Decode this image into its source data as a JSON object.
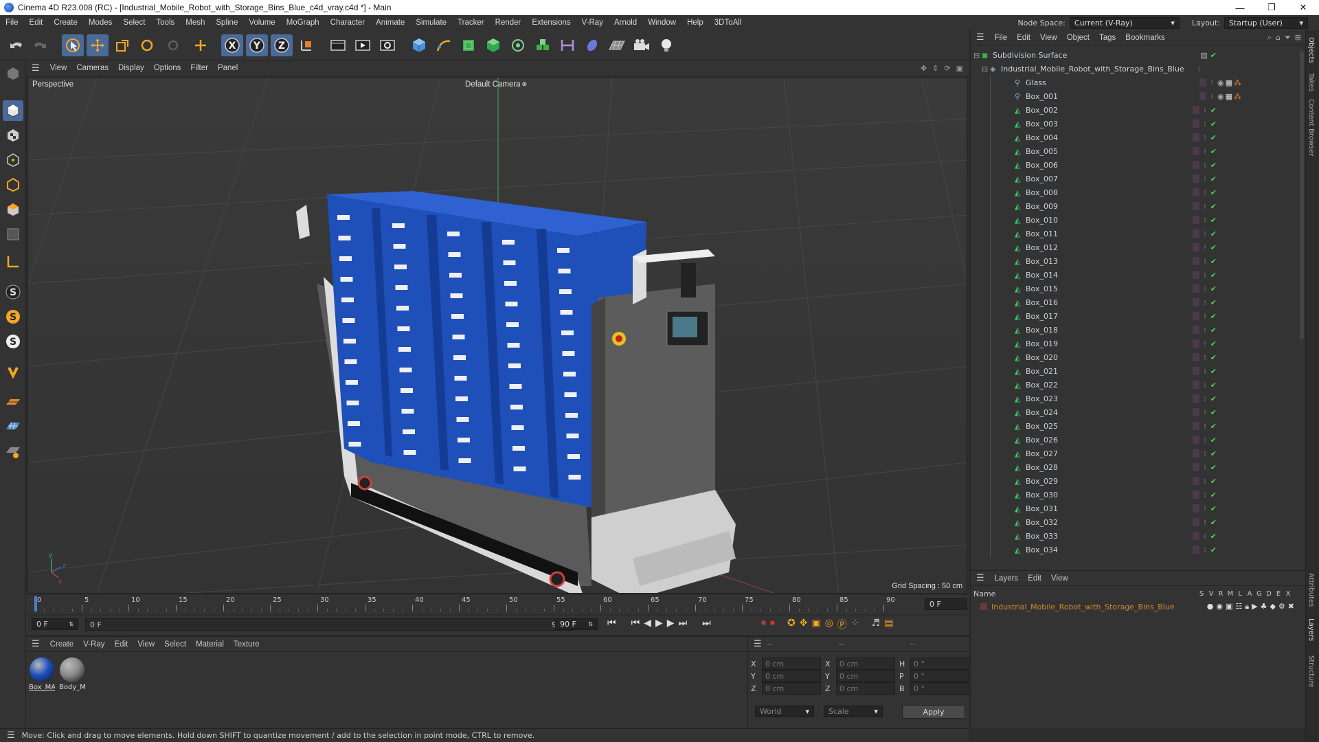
{
  "window": {
    "title": "Cinema 4D R23.008 (RC) - [Industrial_Mobile_Robot_with_Storage_Bins_Blue_c4d_vray.c4d *] - Main",
    "minimize": "—",
    "restore": "❐",
    "close": "✕"
  },
  "menubar": {
    "items": [
      "File",
      "Edit",
      "Create",
      "Modes",
      "Select",
      "Tools",
      "Mesh",
      "Spline",
      "Volume",
      "MoGraph",
      "Character",
      "Animate",
      "Simulate",
      "Tracker",
      "Render",
      "Extensions",
      "V-Ray",
      "Arnold",
      "Window",
      "Help",
      "3DToAll"
    ],
    "node_space_label": "Node Space:",
    "node_space_value": "Current (V-Ray)",
    "layout_label": "Layout:",
    "layout_value": "Startup (User)"
  },
  "viewport": {
    "menu": [
      "View",
      "Cameras",
      "Display",
      "Options",
      "Filter",
      "Panel"
    ],
    "view_name": "Perspective",
    "camera": "Default Camera",
    "grid_spacing": "Grid Spacing : 50 cm"
  },
  "timeline": {
    "ticks": [
      "0",
      "5",
      "10",
      "15",
      "20",
      "25",
      "30",
      "35",
      "40",
      "45",
      "50",
      "55",
      "60",
      "65",
      "70",
      "75",
      "80",
      "85",
      "90"
    ],
    "current_frame_right": "0 F",
    "start_field": "0 F",
    "range_start": "0 F",
    "range_end": "90 F",
    "end_field": "90 F"
  },
  "materials": {
    "menu": [
      "Create",
      "V-Ray",
      "Edit",
      "View",
      "Select",
      "Material",
      "Texture"
    ],
    "items": [
      {
        "name": "Box_MAT",
        "color": "#1e4fbf"
      },
      {
        "name": "Body_MAT",
        "color": "#8a8a8a"
      }
    ]
  },
  "coords": {
    "headers": [
      "--",
      "--",
      "--"
    ],
    "rows": [
      {
        "a": "X",
        "av": "0 cm",
        "b": "X",
        "bv": "0 cm",
        "c": "H",
        "cv": "0 °"
      },
      {
        "a": "Y",
        "av": "0 cm",
        "b": "Y",
        "bv": "0 cm",
        "c": "P",
        "cv": "0 °"
      },
      {
        "a": "Z",
        "av": "0 cm",
        "b": "Z",
        "bv": "0 cm",
        "c": "B",
        "cv": "0 °"
      }
    ],
    "world": "World",
    "scale": "Scale",
    "apply": "Apply"
  },
  "status": "Move: Click and drag to move elements. Hold down SHIFT to quantize movement / add to the selection in point mode, CTRL to remove.",
  "objects": {
    "menu": [
      "File",
      "Edit",
      "View",
      "Object",
      "Tags",
      "Bookmarks"
    ],
    "root": "Subdivision Surface",
    "group": "Industrial_Mobile_Robot_with_Storage_Bins_Blue",
    "items": [
      "Glass",
      "Box_001",
      "Box_002",
      "Box_003",
      "Box_004",
      "Box_005",
      "Box_006",
      "Box_007",
      "Box_008",
      "Box_009",
      "Box_010",
      "Box_011",
      "Box_012",
      "Box_013",
      "Box_014",
      "Box_015",
      "Box_016",
      "Box_017",
      "Box_018",
      "Box_019",
      "Box_020",
      "Box_021",
      "Box_022",
      "Box_023",
      "Box_024",
      "Box_025",
      "Box_026",
      "Box_027",
      "Box_028",
      "Box_029",
      "Box_030",
      "Box_031",
      "Box_032",
      "Box_033",
      "Box_034"
    ]
  },
  "layers": {
    "menu": [
      "Layers",
      "Edit",
      "View"
    ],
    "name_header": "Name",
    "flags": [
      "S",
      "V",
      "R",
      "M",
      "L",
      "A",
      "G",
      "D",
      "E",
      "X"
    ],
    "layer_name": "Industrial_Mobile_Robot_with_Storage_Bins_Blue",
    "layer_color": "#d08a2a"
  },
  "side_tabs": [
    "Objects",
    "Takes",
    "Content Browser",
    "Attributes",
    "Layers",
    "Structure"
  ]
}
